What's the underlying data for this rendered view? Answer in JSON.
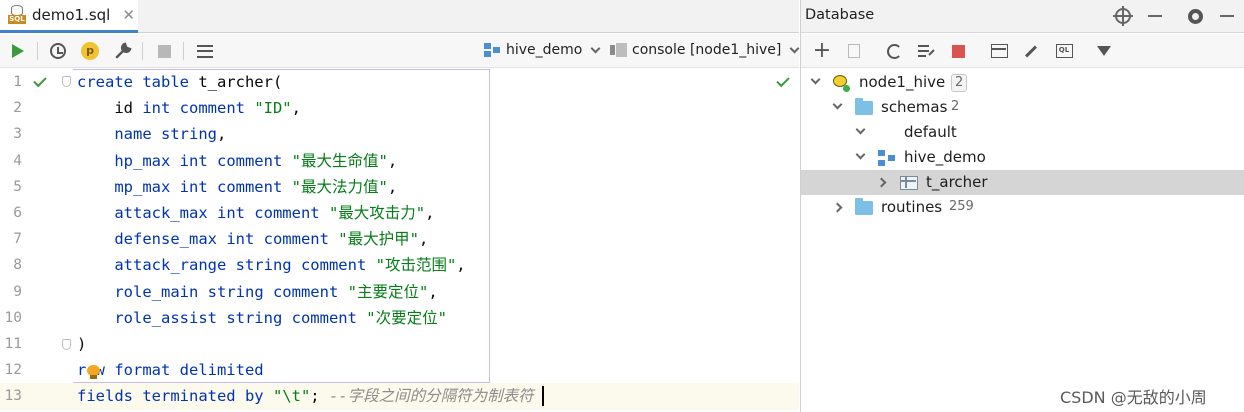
{
  "editor": {
    "tab": {
      "label": "demo1.sql",
      "close": "✕",
      "icon_text": "SQL"
    },
    "toolbar": {
      "execute_icon": "play-icon",
      "history_icon": "clock-icon",
      "explain_label": "p",
      "schema_selector": "hive_demo",
      "console_selector": "console [node1_hive]"
    },
    "lines": [
      {
        "n": "1"
      },
      {
        "n": "2"
      },
      {
        "n": "3"
      },
      {
        "n": "4"
      },
      {
        "n": "5"
      },
      {
        "n": "6"
      },
      {
        "n": "7"
      },
      {
        "n": "8"
      },
      {
        "n": "9"
      },
      {
        "n": "10"
      },
      {
        "n": "11"
      },
      {
        "n": "12"
      },
      {
        "n": "13"
      }
    ],
    "code": {
      "l1_kw": "create table",
      "l1_rest": " t_archer(",
      "l2_id": "    id ",
      "l2_kw": "int comment ",
      "l2_str": "\"ID\"",
      "l2_end": ",",
      "l3_name": "    name ",
      "l3_kw": "string",
      "l3_end": ",",
      "l4_col": "    hp_max ",
      "l4_kw": "int comment ",
      "l4_str": "\"最大生命值\"",
      "l4_end": ",",
      "l5_col": "    mp_max ",
      "l5_kw": "int comment ",
      "l5_str": "\"最大法力值\"",
      "l5_end": ",",
      "l6_col": "    attack_max ",
      "l6_kw": "int comment ",
      "l6_str": "\"最大攻击力\"",
      "l6_end": ",",
      "l7_col": "    defense_max ",
      "l7_kw": "int comment ",
      "l7_str": "\"最大护甲\"",
      "l7_end": ",",
      "l8_col": "    attack_range ",
      "l8_kw": "string comment ",
      "l8_str": "\"攻击范围\"",
      "l8_end": ",",
      "l9_col": "    role_main ",
      "l9_kw": "string comment ",
      "l9_str": "\"主要定位\"",
      "l9_end": ",",
      "l10_col": "    role_assist ",
      "l10_kw": "string comment ",
      "l10_str": "\"次要定位\"",
      "l11": ")",
      "l12_kw": "row format delimited",
      "l13_kw": "fields terminated by ",
      "l13_str": "\"\\t\"",
      "l13_semi": "; ",
      "l13_cmt": "--字段之间的分隔符为制表符"
    }
  },
  "database": {
    "title": "Database",
    "tree": {
      "connection": {
        "label": "node1_hive",
        "count": "2"
      },
      "schemas": {
        "label": "schemas",
        "count": "2"
      },
      "default": {
        "label": "default"
      },
      "hive_demo": {
        "label": "hive_demo"
      },
      "t_archer": {
        "label": "t_archer"
      },
      "routines": {
        "label": "routines",
        "count": "259"
      }
    }
  },
  "watermark": "CSDN @无敌的小周",
  "colors": {
    "keyword": "#0033b3",
    "string": "#067d17",
    "comment": "#8c8c8c",
    "accent": "#4083c9",
    "run_green": "#3c9a3c",
    "stop_red": "#d9534f",
    "selection": "#d5d5d5"
  }
}
